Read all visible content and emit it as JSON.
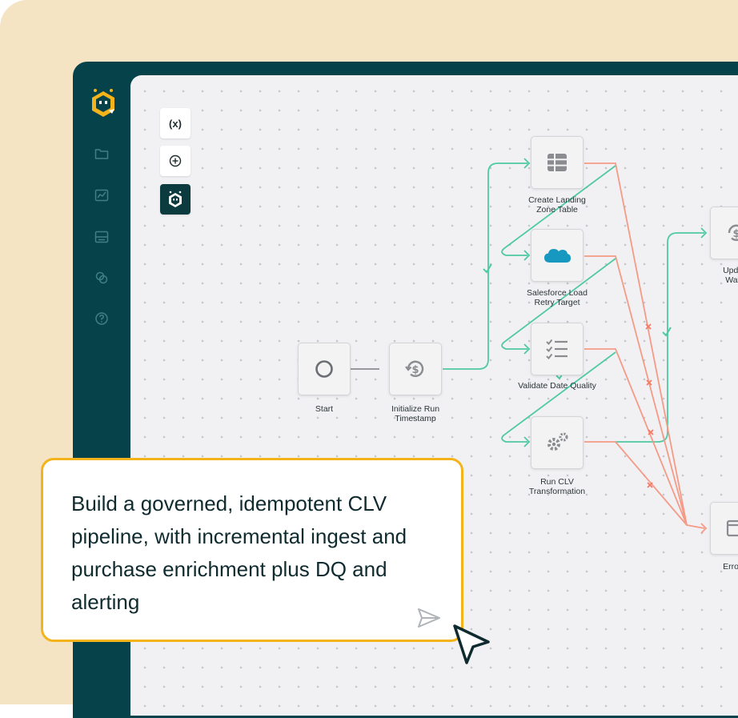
{
  "toolbar": {
    "variables_label": "(x)"
  },
  "sidebar": {
    "items": [
      {
        "icon": "folder-icon"
      },
      {
        "icon": "chart-icon"
      },
      {
        "icon": "storage-icon"
      },
      {
        "icon": "integrations-icon"
      },
      {
        "icon": "help-icon"
      }
    ]
  },
  "nodes": {
    "start": "Start",
    "init_run": "Initialize Run\nTimestamp",
    "landing": "Create Landing\nZone Table",
    "salesforce": "Salesforce Load\nRetry Target",
    "validate": "Validate Date Quality",
    "clv": "Run CLV\nTransformation",
    "update": "Update\nWater",
    "error": "Error H"
  },
  "prompt": {
    "text": "Build a governed, idempotent CLV pipeline, with incremental ingest and purchase enrichment plus DQ and alerting"
  },
  "colors": {
    "sidebar_bg": "#06424a",
    "accent_yellow": "#f4b31a",
    "success_green": "#4fcaa0",
    "error_red": "#f59a86",
    "frame_beige": "#f4e4c4"
  }
}
